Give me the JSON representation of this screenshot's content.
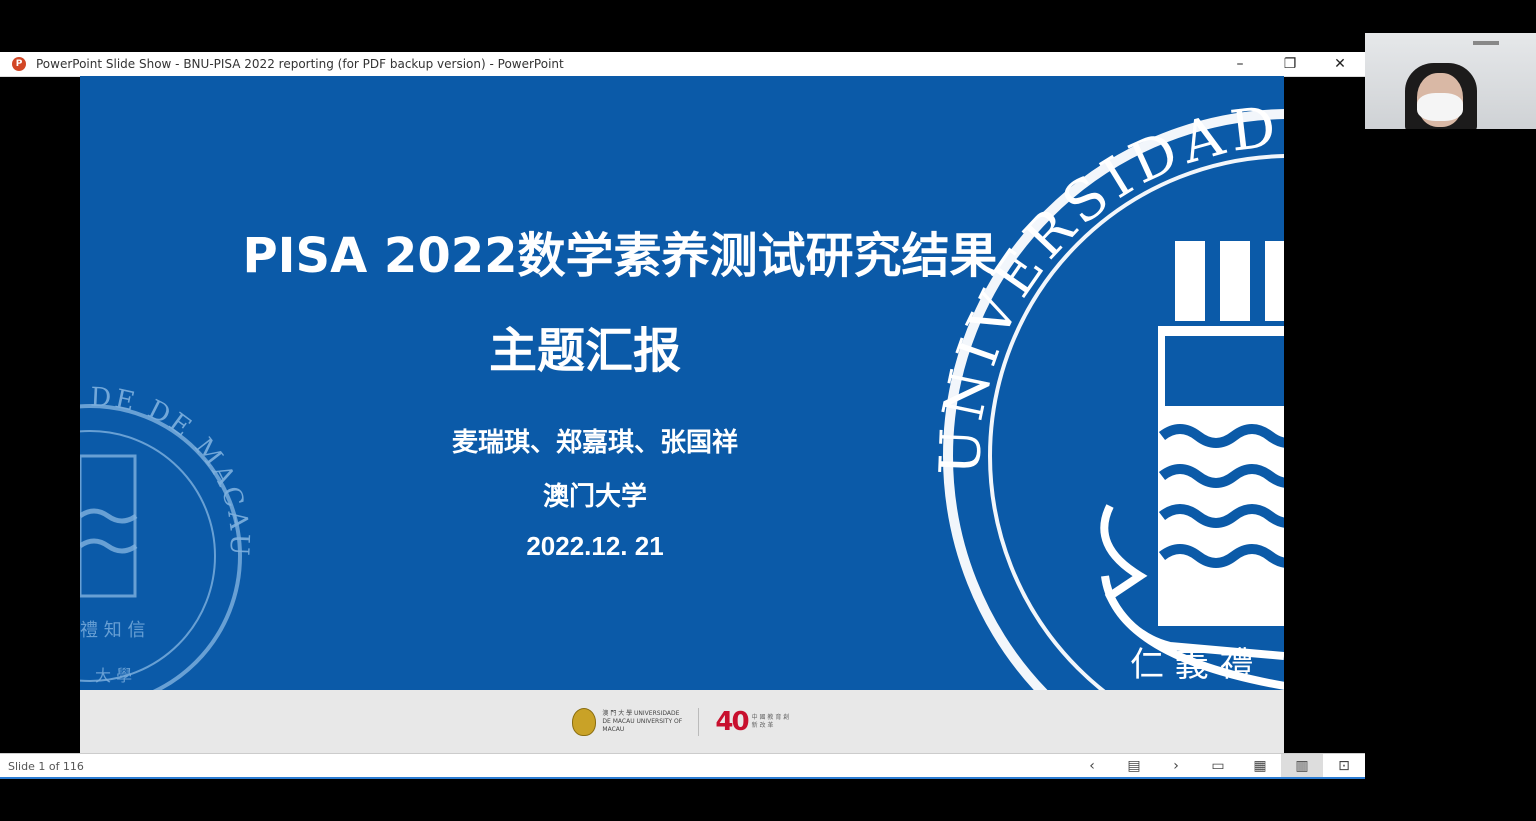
{
  "window": {
    "title": "PowerPoint Slide Show  -  BNU-PISA 2022 reporting (for PDF backup version) - PowerPoint",
    "app_icon": "P",
    "controls": {
      "minimize": "–",
      "restore": "❐",
      "close": "✕"
    }
  },
  "slide": {
    "title": "PISA 2022数学素养测试研究结果",
    "subtitle": "主题汇报",
    "authors": "麦瑞琪、郑嘉琪、张国祥",
    "university": "澳门大学",
    "date": "2022.12. 21",
    "seal_text_large": "UNIVERSIDADE",
    "seal_text_small": "DE DE MACAU",
    "seal_motto": "仁 義 禮",
    "seal_motto_small": "禮 知 信",
    "seal_bottom_small": "大 學",
    "colors": {
      "background": "#0b5aa8",
      "footer": "#e8e8e8"
    },
    "footer": {
      "logo1_text": "澳 門 大 學 UNIVERSIDADE DE MACAU UNIVERSITY OF MACAU",
      "logo2_number": "40",
      "logo2_text": "中 國 教 育 創 新 改 革"
    }
  },
  "statusbar": {
    "slide_count": "Slide 1 of 116",
    "icons": {
      "prev": "‹",
      "slide_menu": "▤",
      "next": "›",
      "normal_view": "▭",
      "sorter_view": "▦",
      "reading_view": "▥",
      "slideshow_view": "⊡"
    }
  }
}
